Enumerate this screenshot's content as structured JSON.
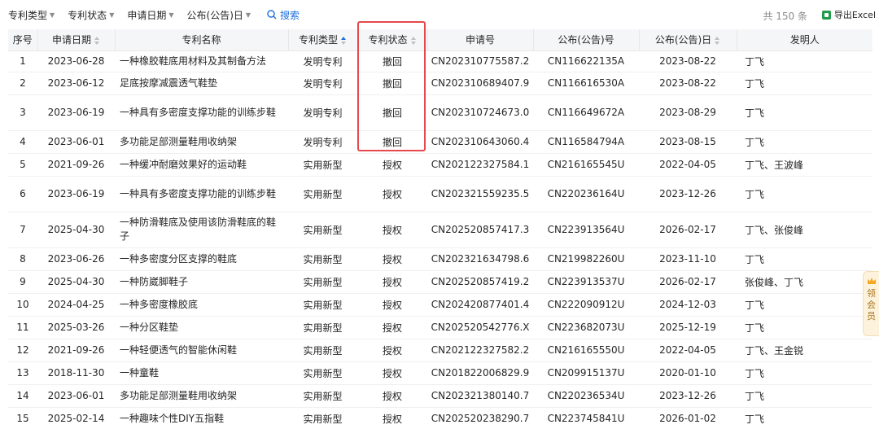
{
  "filters": [
    {
      "label": "专利类型"
    },
    {
      "label": "专利状态"
    },
    {
      "label": "申请日期"
    },
    {
      "label": "公布(公告)日"
    }
  ],
  "search_label": "搜索",
  "total_text": "共 150 条",
  "export_label": "导出Excel",
  "side_widget_text": "领会员",
  "colors": {
    "accent": "#1e6fd9",
    "highlight": "#e5484d",
    "excel": "#1f9d4a"
  },
  "columns": [
    "序号",
    "申请日期",
    "专利名称",
    "专利类型",
    "专利状态",
    "申请号",
    "公布(公告)号",
    "公布(公告)日",
    "发明人"
  ],
  "rows": [
    {
      "no": "1",
      "app_date": "2023-06-28",
      "name": "一种橡胶鞋底用材料及其制备方法",
      "type": "发明专利",
      "status": "撤回",
      "app_no": "CN202310775587.2",
      "pub_no": "CN116622135A",
      "pub_date": "2023-08-22",
      "inventor": "丁飞"
    },
    {
      "no": "2",
      "app_date": "2023-06-12",
      "name": "足底按摩减震透气鞋垫",
      "type": "发明专利",
      "status": "撤回",
      "app_no": "CN202310689407.9",
      "pub_no": "CN116616530A",
      "pub_date": "2023-08-22",
      "inventor": "丁飞"
    },
    {
      "no": "3",
      "app_date": "2023-06-19",
      "name": "一种具有多密度支撑功能的训练步鞋",
      "type": "发明专利",
      "status": "撤回",
      "app_no": "CN202310724673.0",
      "pub_no": "CN116649672A",
      "pub_date": "2023-08-29",
      "inventor": "丁飞"
    },
    {
      "no": "4",
      "app_date": "2023-06-01",
      "name": "多功能足部测量鞋用收纳架",
      "type": "发明专利",
      "status": "撤回",
      "app_no": "CN202310643060.4",
      "pub_no": "CN116584794A",
      "pub_date": "2023-08-15",
      "inventor": "丁飞"
    },
    {
      "no": "5",
      "app_date": "2021-09-26",
      "name": "一种缓冲耐磨效果好的运动鞋",
      "type": "实用新型",
      "status": "授权",
      "app_no": "CN202122327584.1",
      "pub_no": "CN216165545U",
      "pub_date": "2022-04-05",
      "inventor": "丁飞、王波峰"
    },
    {
      "no": "6",
      "app_date": "2023-06-19",
      "name": "一种具有多密度支撑功能的训练步鞋",
      "type": "实用新型",
      "status": "授权",
      "app_no": "CN202321559235.5",
      "pub_no": "CN220236164U",
      "pub_date": "2023-12-26",
      "inventor": "丁飞"
    },
    {
      "no": "7",
      "app_date": "2025-04-30",
      "name": "一种防滑鞋底及使用该防滑鞋底的鞋子",
      "type": "实用新型",
      "status": "授权",
      "app_no": "CN202520857417.3",
      "pub_no": "CN223913564U",
      "pub_date": "2026-02-17",
      "inventor": "丁飞、张俊峰"
    },
    {
      "no": "8",
      "app_date": "2023-06-26",
      "name": "一种多密度分区支撑的鞋底",
      "type": "实用新型",
      "status": "授权",
      "app_no": "CN202321634798.6",
      "pub_no": "CN219982260U",
      "pub_date": "2023-11-10",
      "inventor": "丁飞"
    },
    {
      "no": "9",
      "app_date": "2025-04-30",
      "name": "一种防崴脚鞋子",
      "type": "实用新型",
      "status": "授权",
      "app_no": "CN202520857419.2",
      "pub_no": "CN223913537U",
      "pub_date": "2026-02-17",
      "inventor": "张俊峰、丁飞"
    },
    {
      "no": "10",
      "app_date": "2024-04-25",
      "name": "一种多密度橡胶底",
      "type": "实用新型",
      "status": "授权",
      "app_no": "CN202420877401.4",
      "pub_no": "CN222090912U",
      "pub_date": "2024-12-03",
      "inventor": "丁飞"
    },
    {
      "no": "11",
      "app_date": "2025-03-26",
      "name": "一种分区鞋垫",
      "type": "实用新型",
      "status": "授权",
      "app_no": "CN202520542776.X",
      "pub_no": "CN223682073U",
      "pub_date": "2025-12-19",
      "inventor": "丁飞"
    },
    {
      "no": "12",
      "app_date": "2021-09-26",
      "name": "一种轻便透气的智能休闲鞋",
      "type": "实用新型",
      "status": "授权",
      "app_no": "CN202122327582.2",
      "pub_no": "CN216165550U",
      "pub_date": "2022-04-05",
      "inventor": "丁飞、王金锐"
    },
    {
      "no": "13",
      "app_date": "2018-11-30",
      "name": "一种童鞋",
      "type": "实用新型",
      "status": "授权",
      "app_no": "CN201822006829.9",
      "pub_no": "CN209915137U",
      "pub_date": "2020-01-10",
      "inventor": "丁飞"
    },
    {
      "no": "14",
      "app_date": "2023-06-01",
      "name": "多功能足部测量鞋用收纳架",
      "type": "实用新型",
      "status": "授权",
      "app_no": "CN202321380140.7",
      "pub_no": "CN220236534U",
      "pub_date": "2023-12-26",
      "inventor": "丁飞"
    },
    {
      "no": "15",
      "app_date": "2025-02-14",
      "name": "一种趣味个性DIY五指鞋",
      "type": "实用新型",
      "status": "授权",
      "app_no": "CN202520238290.7",
      "pub_no": "CN223745841U",
      "pub_date": "2026-01-02",
      "inventor": "丁飞"
    }
  ]
}
